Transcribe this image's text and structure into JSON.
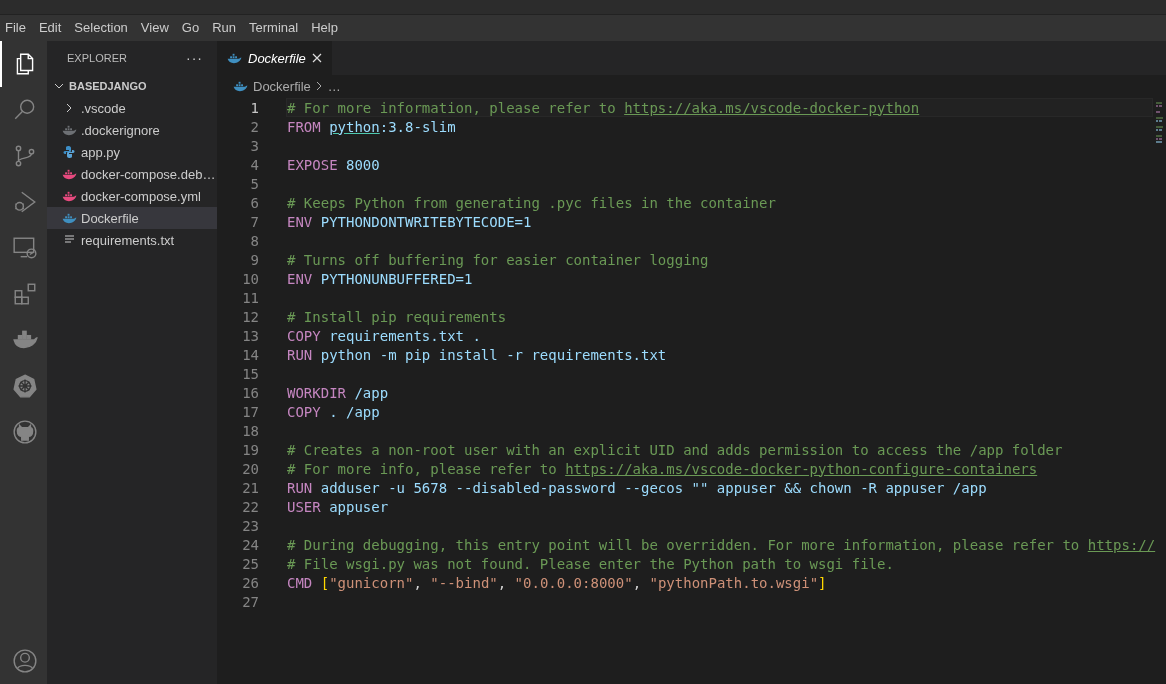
{
  "menu": [
    "File",
    "Edit",
    "Selection",
    "View",
    "Go",
    "Run",
    "Terminal",
    "Help"
  ],
  "activity_bar": [
    {
      "kind": "explorer",
      "selected": true
    },
    {
      "kind": "search",
      "selected": false
    },
    {
      "kind": "source-control",
      "selected": false
    },
    {
      "kind": "debug",
      "selected": false
    },
    {
      "kind": "remote",
      "selected": false
    },
    {
      "kind": "extensions",
      "selected": false
    },
    {
      "kind": "docker",
      "selected": false
    },
    {
      "kind": "kubernetes",
      "selected": false
    },
    {
      "kind": "github",
      "selected": false
    }
  ],
  "account": {
    "kind": "account"
  },
  "sidebar": {
    "title": "EXPLORER",
    "more": "···",
    "folder": {
      "name": "BASEDJANGO",
      "expanded": true,
      "items": [
        {
          "name": ".vscode",
          "kind": "folder",
          "expanded": false,
          "selected": false
        },
        {
          "name": ".dockerignore",
          "kind": "dockerignore",
          "selected": false
        },
        {
          "name": "app.py",
          "kind": "python",
          "selected": false
        },
        {
          "name": "docker-compose.deb…",
          "kind": "compose",
          "selected": false
        },
        {
          "name": "docker-compose.yml",
          "kind": "compose",
          "selected": false
        },
        {
          "name": "Dockerfile",
          "kind": "dockerfile",
          "selected": true
        },
        {
          "name": "requirements.txt",
          "kind": "text",
          "selected": false
        }
      ]
    }
  },
  "tabs": [
    {
      "label": "Dockerfile",
      "selected": true,
      "preview": true
    }
  ],
  "breadcrumb": [
    "Dockerfile",
    "…"
  ],
  "editor": {
    "lines": [
      {
        "n": "1",
        "current": true,
        "tokens": [
          {
            "kind": "comment",
            "text": "# For more information, please refer to "
          },
          {
            "kind": "link",
            "text": "https://aka.ms/vscode-docker-python"
          }
        ]
      },
      {
        "n": "2",
        "current": false,
        "tokens": [
          {
            "kind": "keyword",
            "text": "FROM "
          },
          {
            "kind": "image",
            "text": "python"
          },
          {
            "kind": "value",
            "text": ":3.8-slim"
          }
        ]
      },
      {
        "n": "3",
        "current": false
      },
      {
        "n": "4",
        "current": false,
        "tokens": [
          {
            "kind": "keyword",
            "text": "EXPOSE "
          },
          {
            "kind": "value",
            "text": "8000"
          }
        ]
      },
      {
        "n": "5",
        "current": false
      },
      {
        "n": "6",
        "current": false,
        "tokens": [
          {
            "kind": "comment",
            "text": "# Keeps Python from generating .pyc files in the container"
          }
        ]
      },
      {
        "n": "7",
        "current": false,
        "tokens": [
          {
            "kind": "keyword",
            "text": "ENV "
          },
          {
            "kind": "value",
            "text": "PYTHONDONTWRITEBYTECODE=1"
          }
        ]
      },
      {
        "n": "8",
        "current": false
      },
      {
        "n": "9",
        "current": false,
        "tokens": [
          {
            "kind": "comment",
            "text": "# Turns off buffering for easier container logging"
          }
        ]
      },
      {
        "n": "10",
        "current": false,
        "tokens": [
          {
            "kind": "keyword",
            "text": "ENV "
          },
          {
            "kind": "value",
            "text": "PYTHONUNBUFFERED=1"
          }
        ]
      },
      {
        "n": "11",
        "current": false
      },
      {
        "n": "12",
        "current": false,
        "tokens": [
          {
            "kind": "comment",
            "text": "# Install pip requirements"
          }
        ]
      },
      {
        "n": "13",
        "current": false,
        "tokens": [
          {
            "kind": "keyword",
            "text": "COPY "
          },
          {
            "kind": "value",
            "text": "requirements.txt ."
          }
        ]
      },
      {
        "n": "14",
        "current": false,
        "tokens": [
          {
            "kind": "keyword",
            "text": "RUN "
          },
          {
            "kind": "value",
            "text": "python -m pip install -r requirements.txt"
          }
        ]
      },
      {
        "n": "15",
        "current": false
      },
      {
        "n": "16",
        "current": false,
        "tokens": [
          {
            "kind": "keyword",
            "text": "WORKDIR "
          },
          {
            "kind": "value",
            "text": "/app"
          }
        ]
      },
      {
        "n": "17",
        "current": false,
        "tokens": [
          {
            "kind": "keyword",
            "text": "COPY "
          },
          {
            "kind": "value",
            "text": ". /app"
          }
        ]
      },
      {
        "n": "18",
        "current": false
      },
      {
        "n": "19",
        "current": false,
        "tokens": [
          {
            "kind": "comment",
            "text": "# Creates a non-root user with an explicit UID and adds permission to access the /app folder"
          }
        ]
      },
      {
        "n": "20",
        "current": false,
        "tokens": [
          {
            "kind": "comment",
            "text": "# For more info, please refer to "
          },
          {
            "kind": "link",
            "text": "https://aka.ms/vscode-docker-python-configure-containers"
          }
        ]
      },
      {
        "n": "21",
        "current": false,
        "tokens": [
          {
            "kind": "keyword",
            "text": "RUN "
          },
          {
            "kind": "value",
            "text": "adduser -u 5678 --disabled-password --gecos \"\" appuser && chown -R appuser /app"
          }
        ]
      },
      {
        "n": "22",
        "current": false,
        "tokens": [
          {
            "kind": "keyword",
            "text": "USER "
          },
          {
            "kind": "value",
            "text": "appuser"
          }
        ]
      },
      {
        "n": "23",
        "current": false
      },
      {
        "n": "24",
        "current": false,
        "tokens": [
          {
            "kind": "comment",
            "text": "# During debugging, this entry point will be overridden. For more information, please refer to "
          },
          {
            "kind": "link",
            "text": "https://"
          }
        ]
      },
      {
        "n": "25",
        "current": false,
        "tokens": [
          {
            "kind": "comment",
            "text": "# File wsgi.py was not found. Please enter the Python path to wsgi file."
          }
        ]
      },
      {
        "n": "26",
        "current": false,
        "tokens": [
          {
            "kind": "keyword",
            "text": "CMD "
          },
          {
            "kind": "bracket",
            "text": "["
          },
          {
            "kind": "string",
            "text": "\"gunicorn\""
          },
          {
            "kind": "punct",
            "text": ", "
          },
          {
            "kind": "string",
            "text": "\"--bind\""
          },
          {
            "kind": "punct",
            "text": ", "
          },
          {
            "kind": "string",
            "text": "\"0.0.0.0:8000\""
          },
          {
            "kind": "punct",
            "text": ", "
          },
          {
            "kind": "string",
            "text": "\"pythonPath.to.wsgi\""
          },
          {
            "kind": "bracket",
            "text": "]"
          }
        ]
      },
      {
        "n": "27",
        "current": false
      }
    ]
  }
}
